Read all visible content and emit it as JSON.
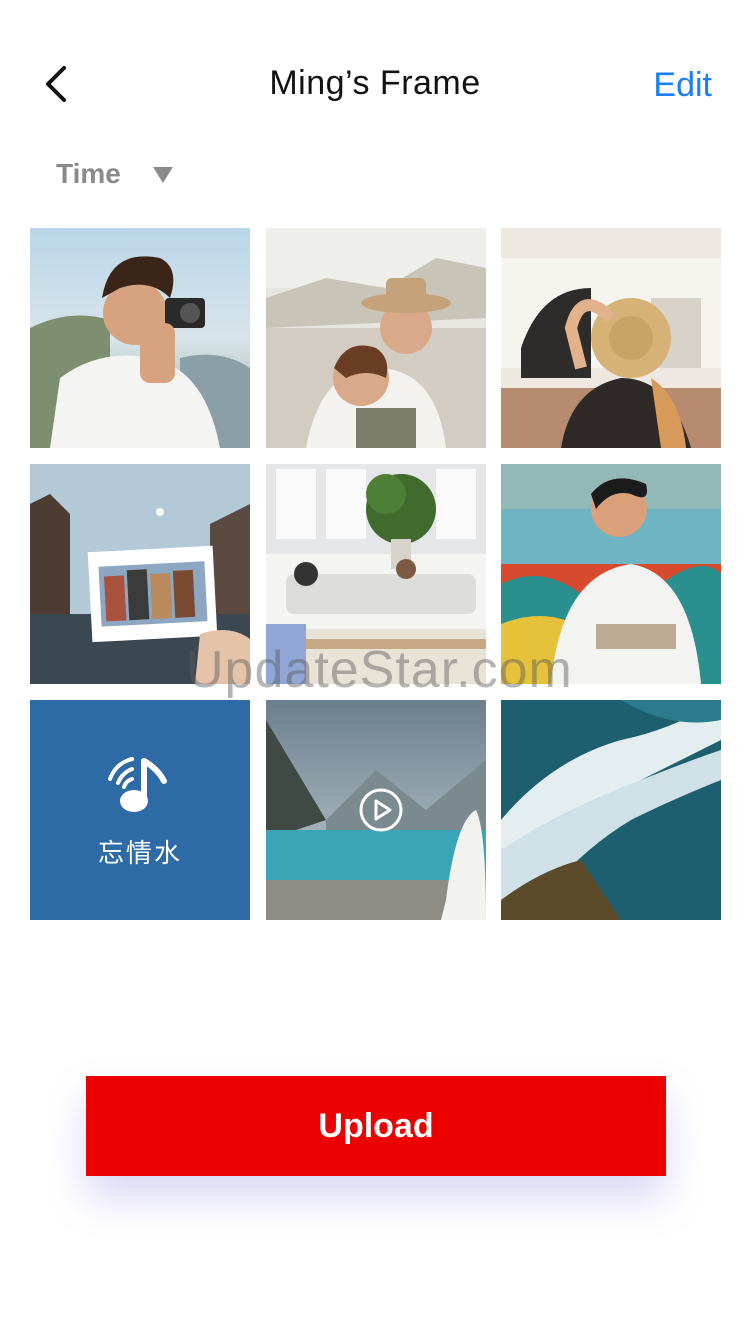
{
  "header": {
    "title": "Ming’s Frame",
    "edit_label": "Edit",
    "back_icon": "chevron-left-icon"
  },
  "sort": {
    "label": "Time",
    "icon": "triangle-down-icon"
  },
  "grid": {
    "tiles": [
      {
        "type": "photo",
        "name": "photo-man-camera"
      },
      {
        "type": "photo",
        "name": "photo-couple-beach"
      },
      {
        "type": "photo",
        "name": "photo-woman-hat"
      },
      {
        "type": "photo",
        "name": "photo-amsterdam-postcard"
      },
      {
        "type": "photo",
        "name": "photo-living-room"
      },
      {
        "type": "photo",
        "name": "photo-man-graffiti"
      },
      {
        "type": "audio",
        "name": "audio-tile",
        "label": "忘情水",
        "icon": "music-note-icon"
      },
      {
        "type": "video",
        "name": "video-lake",
        "icon": "play-circle-icon"
      },
      {
        "type": "photo",
        "name": "photo-ocean-waves"
      }
    ]
  },
  "watermark": "UpdateStar.com",
  "upload": {
    "label": "Upload"
  },
  "colors": {
    "accent": "#1a7ff2",
    "upload_bg": "#ec0000",
    "music_tile": "#2d6aa6"
  }
}
